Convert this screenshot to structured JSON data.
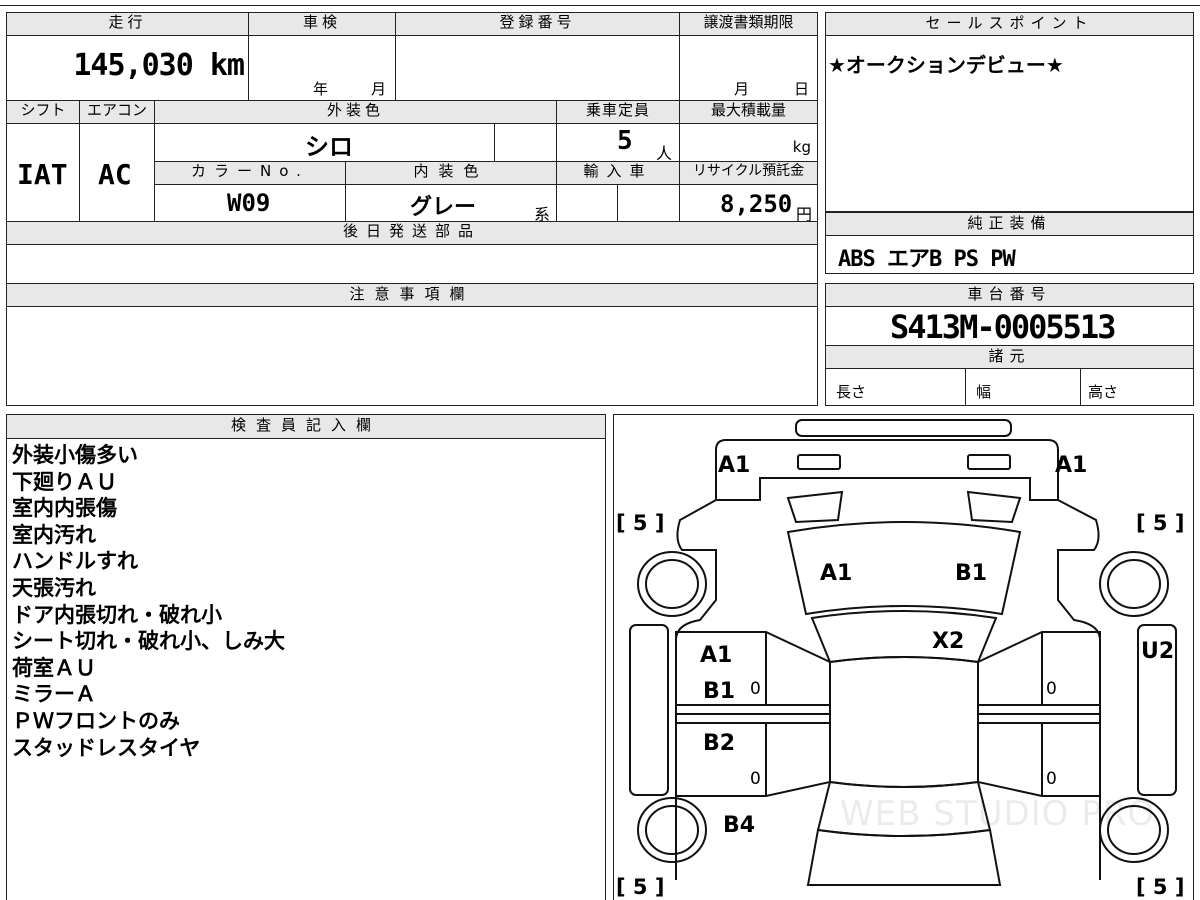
{
  "header": {
    "mileage_label": "走行",
    "mileage_value": "145,030 km",
    "inspection_label": "車検",
    "inspection_year": "年",
    "inspection_month": "月",
    "registration_label": "登録番号",
    "transfer_label": "譲渡書類期限",
    "transfer_month": "月",
    "transfer_day": "日",
    "shift_label": "シフト",
    "shift_value": "IAT",
    "aircon_label": "エアコン",
    "aircon_value": "AC",
    "exterior_color_label": "外装色",
    "exterior_color_value": "シロ",
    "color_no_label": "カラーNo.",
    "color_no_value": "W09",
    "interior_color_label": "内装色",
    "interior_color_value": "グレー",
    "interior_suffix": "系",
    "capacity_label": "乗車定員",
    "capacity_value": "5",
    "capacity_unit": "人",
    "max_load_label": "最大積載量",
    "max_load_unit": "kg",
    "import_label": "輸入車",
    "recycle_label": "リサイクル預託金",
    "recycle_value": "8,250",
    "recycle_unit": "円",
    "later_parts_label": "後日発送部品"
  },
  "sales_point": {
    "label": "セールスポイント",
    "text": "★オークションデビュー★"
  },
  "equipment": {
    "label": "純正装備",
    "text": "ABS エアB PS PW"
  },
  "notes": {
    "label": "注意事項欄"
  },
  "chassis": {
    "label": "車台番号",
    "value": "S413M-0005513",
    "spec_label": "諸元",
    "length_label": "長さ",
    "width_label": "幅",
    "height_label": "高さ"
  },
  "inspector": {
    "label": "検査員記入欄",
    "items": [
      "外装小傷多い",
      "下廻りＡＵ",
      "室内内張傷",
      "室内汚れ",
      "ハンドルすれ",
      "天張汚れ",
      "ドア内張切れ・破れ小",
      "シート切れ・破れ小、しみ大",
      "荷室ＡＵ",
      "ミラーＡ",
      "ＰＷフロントのみ",
      "スタッドレスタイヤ"
    ]
  },
  "diagram": {
    "front_left": "A1",
    "front_right": "A1",
    "hood_left": "A1",
    "hood_right": "B1",
    "roof": "X2",
    "right_side": "U2",
    "door_fl_1": "A1",
    "door_fl_2": "B1",
    "door_rl": "B2",
    "rear_left": "B4",
    "door_count_fl": "0",
    "door_count_rl": "0",
    "door_count_fr": "0",
    "door_count_rr": "0",
    "tire_fl": "[ 5 ]",
    "tire_fr": "[ 5 ]",
    "tire_rl": "[ 5 ]",
    "tire_rr": "[ 5 ]",
    "watermark": "WEB STUDIO PRO"
  }
}
